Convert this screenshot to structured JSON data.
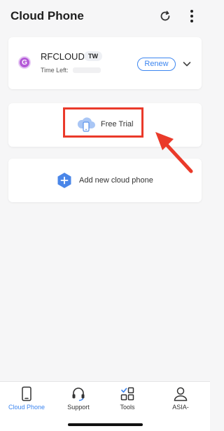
{
  "header": {
    "title": "Cloud Phone",
    "refresh_icon": "refresh-icon",
    "more_icon": "more-vertical-icon"
  },
  "phone_card": {
    "avatar_letter": "G",
    "name": "RFCLOUD",
    "region": "TW",
    "time_left_label": "Time Left:",
    "renew_label": "Renew",
    "expand_icon": "chevron-down-icon"
  },
  "trial_card": {
    "label": "Free Trial",
    "icon": "cloud-phone-icon"
  },
  "add_card": {
    "label": "Add new cloud phone",
    "icon": "plus-hexagon-icon"
  },
  "tabbar": {
    "tabs": [
      {
        "label": "Cloud Phone",
        "icon": "phone-icon",
        "active": true
      },
      {
        "label": "Support",
        "icon": "headset-icon",
        "active": false
      },
      {
        "label": "Tools",
        "icon": "tools-grid-icon",
        "active": false
      },
      {
        "label": "ASIA-",
        "icon": "user-icon",
        "active": false
      }
    ]
  },
  "colors": {
    "accent": "#3d86f0",
    "highlight": "#ea3a2a",
    "background": "#f6f6f7"
  }
}
